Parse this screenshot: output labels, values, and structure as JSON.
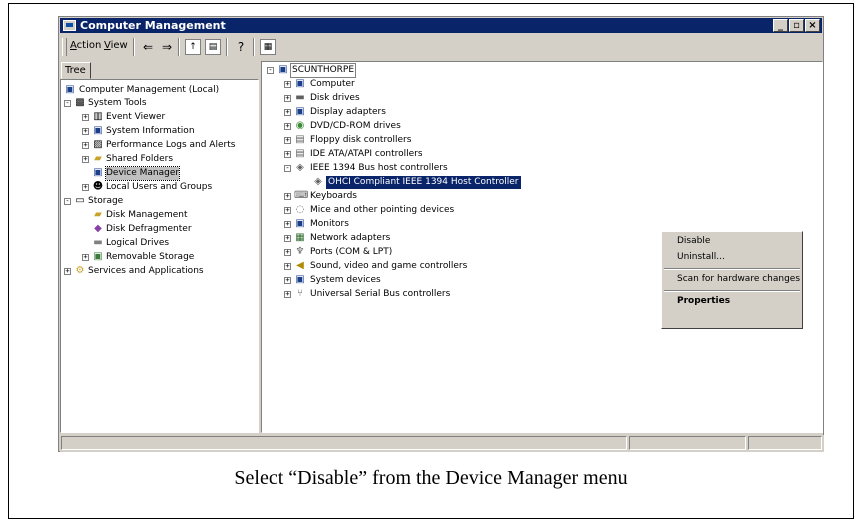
{
  "window": {
    "title": "Computer Management",
    "buttons": {
      "minimize": "_",
      "maximize": "▫",
      "close": "×"
    }
  },
  "menubar": {
    "action": "Action",
    "view": "View"
  },
  "left_pane": {
    "tab": "Tree",
    "items": [
      {
        "label": "Computer Management (Local)"
      },
      {
        "label": "System Tools"
      },
      {
        "label": "Event Viewer"
      },
      {
        "label": "System Information"
      },
      {
        "label": "Performance Logs and Alerts"
      },
      {
        "label": "Shared Folders"
      },
      {
        "label": "Device Manager"
      },
      {
        "label": "Local Users and Groups"
      },
      {
        "label": "Storage"
      },
      {
        "label": "Disk Management"
      },
      {
        "label": "Disk Defragmenter"
      },
      {
        "label": "Logical Drives"
      },
      {
        "label": "Removable Storage"
      },
      {
        "label": "Services and Applications"
      }
    ]
  },
  "right_pane": {
    "root": "SCUNTHORPE",
    "items": [
      {
        "label": "Computer"
      },
      {
        "label": "Disk drives"
      },
      {
        "label": "Display adapters"
      },
      {
        "label": "DVD/CD-ROM drives"
      },
      {
        "label": "Floppy disk controllers"
      },
      {
        "label": "IDE ATA/ATAPI controllers"
      },
      {
        "label": "IEEE 1394 Bus host controllers"
      },
      {
        "label": "OHCI Compliant IEEE 1394 Host Controller"
      },
      {
        "label": "Keyboards"
      },
      {
        "label": "Mice and other pointing devices"
      },
      {
        "label": "Monitors"
      },
      {
        "label": "Network adapters"
      },
      {
        "label": "Ports (COM & LPT)"
      },
      {
        "label": "Sound, video and game controllers"
      },
      {
        "label": "System devices"
      },
      {
        "label": "Universal Serial Bus controllers"
      }
    ]
  },
  "context_menu": {
    "disable": "Disable",
    "uninstall": "Uninstall...",
    "scan": "Scan for hardware changes",
    "properties": "Properties"
  },
  "caption": "Select “Disable” from the Device Manager menu"
}
